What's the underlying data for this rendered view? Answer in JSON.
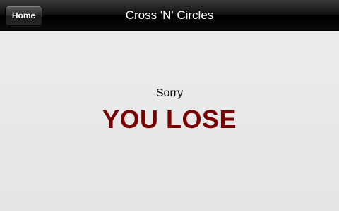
{
  "navbar": {
    "home_label": "Home",
    "title": "Cross 'N' Circles"
  },
  "result": {
    "subtitle": "Sorry",
    "headline": "YOU LOSE"
  },
  "colors": {
    "headline": "#7a0000",
    "background": "#e9e9e9",
    "navbar": "#000000"
  }
}
